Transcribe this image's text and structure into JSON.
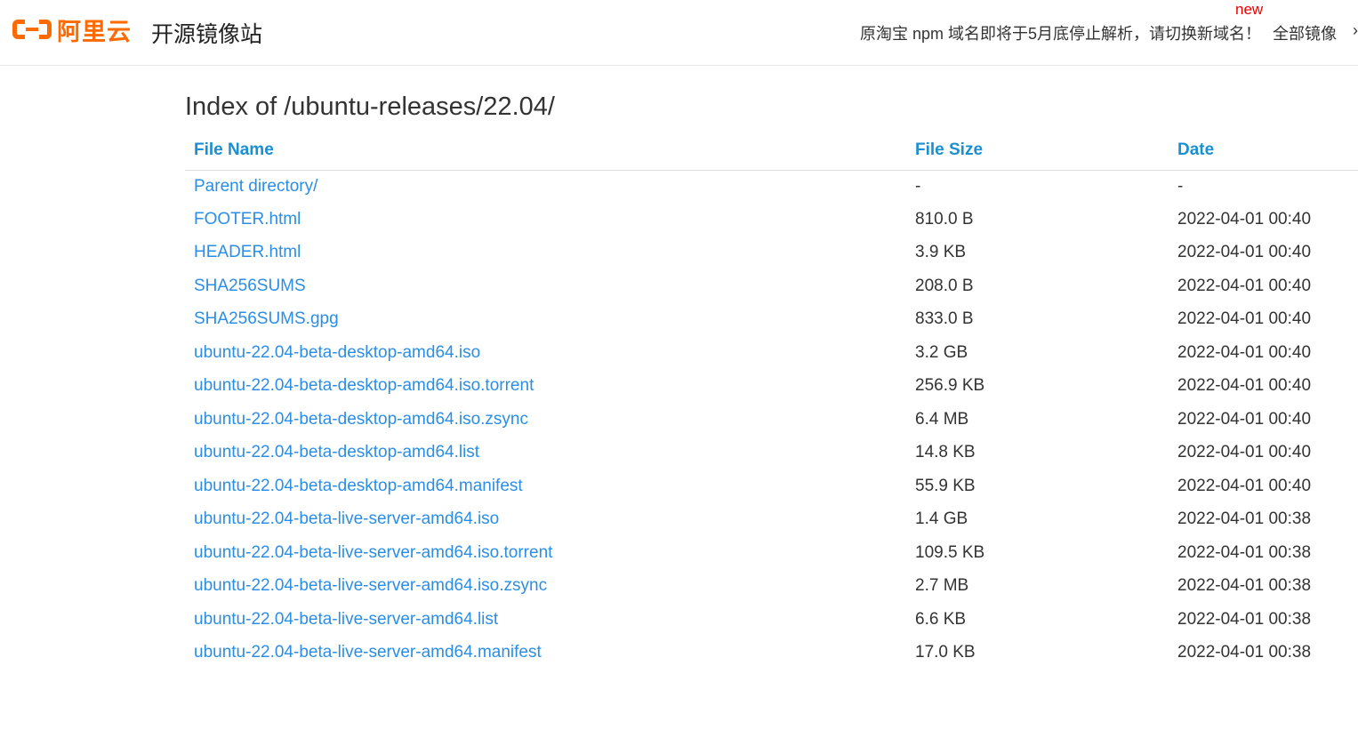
{
  "header": {
    "logo_text": "阿里云",
    "site_title": "开源镜像站",
    "notice": "原淘宝 npm 域名即将于5月底停止解析，请切换新域名！",
    "new_badge": "new",
    "nav_all": "全部镜像",
    "colors": {
      "brand": "#ff6a00",
      "badge": "#ee0000"
    }
  },
  "main": {
    "heading": "Index of /ubuntu-releases/22.04/",
    "columns": {
      "name": "File Name",
      "size": "File Size",
      "date": "Date"
    },
    "link_color": "#2b8ee6",
    "rows": [
      {
        "name": "Parent directory/",
        "size": "-",
        "date": "-"
      },
      {
        "name": "FOOTER.html",
        "size": "810.0 B",
        "date": "2022-04-01 00:40"
      },
      {
        "name": "HEADER.html",
        "size": "3.9 KB",
        "date": "2022-04-01 00:40"
      },
      {
        "name": "SHA256SUMS",
        "size": "208.0 B",
        "date": "2022-04-01 00:40"
      },
      {
        "name": "SHA256SUMS.gpg",
        "size": "833.0 B",
        "date": "2022-04-01 00:40"
      },
      {
        "name": "ubuntu-22.04-beta-desktop-amd64.iso",
        "size": "3.2 GB",
        "date": "2022-04-01 00:40"
      },
      {
        "name": "ubuntu-22.04-beta-desktop-amd64.iso.torrent",
        "size": "256.9 KB",
        "date": "2022-04-01 00:40"
      },
      {
        "name": "ubuntu-22.04-beta-desktop-amd64.iso.zsync",
        "size": "6.4 MB",
        "date": "2022-04-01 00:40"
      },
      {
        "name": "ubuntu-22.04-beta-desktop-amd64.list",
        "size": "14.8 KB",
        "date": "2022-04-01 00:40"
      },
      {
        "name": "ubuntu-22.04-beta-desktop-amd64.manifest",
        "size": "55.9 KB",
        "date": "2022-04-01 00:40"
      },
      {
        "name": "ubuntu-22.04-beta-live-server-amd64.iso",
        "size": "1.4 GB",
        "date": "2022-04-01 00:38"
      },
      {
        "name": "ubuntu-22.04-beta-live-server-amd64.iso.torrent",
        "size": "109.5 KB",
        "date": "2022-04-01 00:38"
      },
      {
        "name": "ubuntu-22.04-beta-live-server-amd64.iso.zsync",
        "size": "2.7 MB",
        "date": "2022-04-01 00:38"
      },
      {
        "name": "ubuntu-22.04-beta-live-server-amd64.list",
        "size": "6.6 KB",
        "date": "2022-04-01 00:38"
      },
      {
        "name": "ubuntu-22.04-beta-live-server-amd64.manifest",
        "size": "17.0 KB",
        "date": "2022-04-01 00:38"
      }
    ]
  }
}
